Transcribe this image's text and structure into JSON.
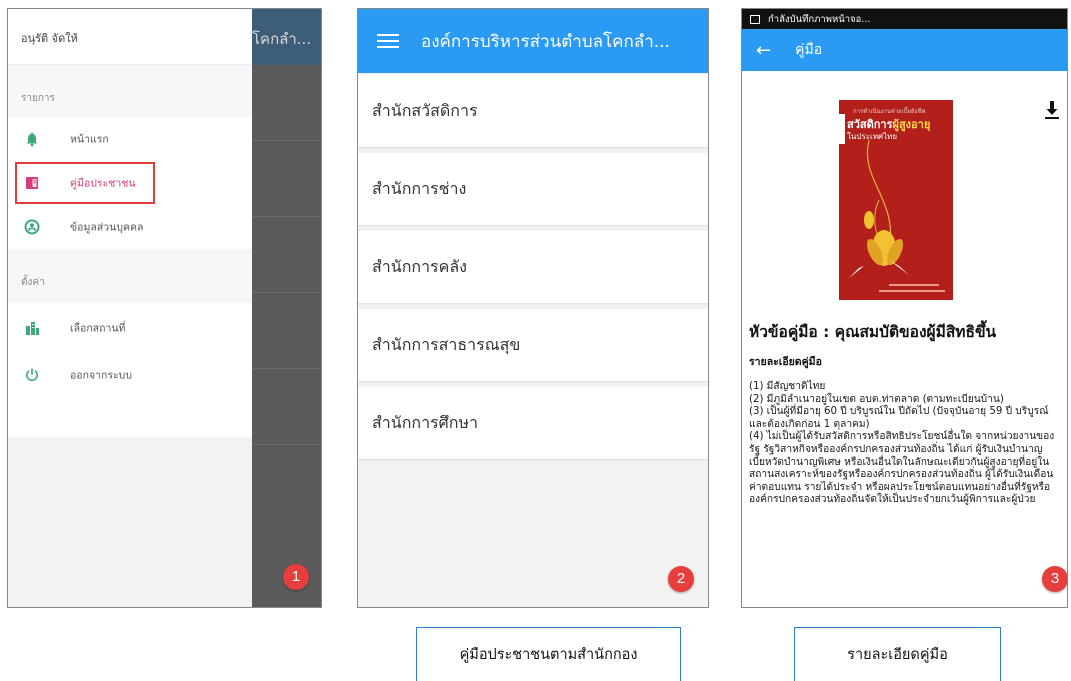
{
  "panel1": {
    "background_title": "โคกลำ...",
    "drawer": {
      "user_name": "อนุรัติ จัดให้",
      "menu_section": "รายการ",
      "menu_items": [
        {
          "label": "หน้าแรก",
          "icon": "home-bell-icon",
          "color": "#3fa97a"
        },
        {
          "label": "คู่มือประชาชน",
          "icon": "book-icon",
          "color": "#d93a79",
          "active": true
        },
        {
          "label": "ข้อมูลส่วนบุคคล",
          "icon": "person-icon",
          "color": "#3fa97a"
        }
      ],
      "settings_section": "ตั้งค่า",
      "settings_items": [
        {
          "label": "เลือกสถานที่",
          "icon": "building-icon",
          "color": "#3fa97a"
        },
        {
          "label": "ออกจากระบบ",
          "icon": "power-icon",
          "color": "#3fa97a"
        }
      ]
    },
    "step_badge": "1"
  },
  "panel2": {
    "title": "องค์การบริหารส่วนตำบลโคกลำ...",
    "offices": [
      "สำนักสวัสดิการ",
      "สำนักการช่าง",
      "สำนักการคลัง",
      "สำนักการสาธารณสุข",
      "สำนักการศึกษา"
    ],
    "step_badge": "2"
  },
  "panel3": {
    "status_text": "กำลังบันทึกภาพหน้าจอ...",
    "title": "คู่มือ",
    "cover": {
      "subtitle": "การดำเนินงานจ่ายเบี้ยยังชีพ",
      "title_white": "สวัสดิการ",
      "title_yellow": "ผู้สูงอายุ",
      "line2": "ในประเทศไทย"
    },
    "heading": "หัวข้อคู่มือ : คุณสมบัติของผู้มีสิทธิขึ้น",
    "subheading": "รายละเอียดคู่มือ",
    "body": "(1) มีสัญชาติไทย\n(2) มีภูมิลำเนาอยู่ในเขต อบต.ท่าตลาด (ตามทะเบียนบ้าน)\n(3) เป็นผู้ที่มีอายุ 60 ปี บริบูรณ์ใน ปีถัดไป (ปัจจุบันอายุ 59 ปี บริบูรณ์ และต้องเกิดก่อน 1 ตุลาคม)\n(4) ไม่เป็นผู้ได้รับสวัสดิการหรือสิทธิประโยชน์อื่นใด จากหน่วยงานของรัฐ รัฐวิสาหกิจหรือองค์กรปกครองส่วนท้องถิ่น ได้แก่ ผู้รับเงินบำนาญ เบี้ยหวัดบำนาญพิเศษ หรือเงินอื่นใดในลักษณะเดียวกันผู้สูงอายุที่อยู่ในสถานสงเคราะห์ของรัฐหรือองค์กรปกครองส่วนท้องถิ่น ผู้ได้รับเงินเดือน ค่าตอบแทน รายได้ประจำ หรือผลประโยชน์ตอบแทนอย่างอื่นที่รัฐหรือองค์กรปกครองส่วนท้องถิ่นจัดให้เป็นประจำยกเว้นผู้พิการและผู้ป่วย",
    "step_badge": "3"
  },
  "captions": {
    "panel2": "คู่มือประชาชนตามสำนักกอง",
    "panel3": "รายละเอียดคู่มือ"
  },
  "colors": {
    "appbar_blue": "#2b9af3",
    "badge_red": "#e63d3d",
    "highlight_red": "#e23c3c",
    "active_pink": "#d93a79",
    "cover_red": "#b31f1a"
  }
}
